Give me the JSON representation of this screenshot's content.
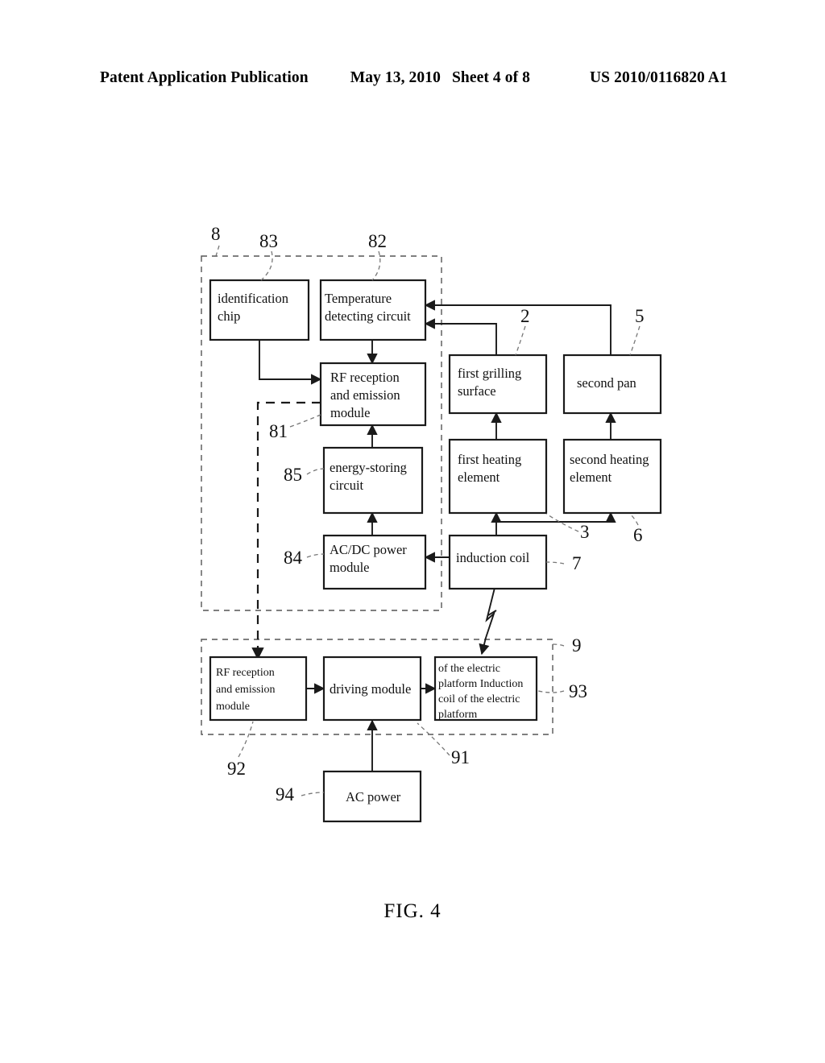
{
  "header": {
    "title": "Patent Application Publication",
    "date": "May 13, 2010",
    "sheet": "Sheet 4 of 8",
    "publication_number": "US 2010/0116820 A1"
  },
  "figure": {
    "caption": "FIG. 4"
  },
  "nodes": {
    "identification_chip": "identification chip",
    "temperature_detecting_circuit": "Temperature detecting circuit",
    "rf_module_upper": "RF reception and emission module",
    "energy_storing_circuit": "energy-storing circuit",
    "acdc_power_module": "AC/DC power module",
    "first_grilling_surface": "first grilling surface",
    "second_pan": "second pan",
    "first_heating_element": "first heating element",
    "second_heating_element": "second heating element",
    "induction_coil": "induction coil",
    "rf_module_lower": "RF reception and emission module",
    "driving_module": "driving module",
    "platform_induction_coil": "of the electric platform Induction coil of the electric platform",
    "ac_power": "AC power"
  },
  "node_lines": {
    "identification_chip": [
      "identification",
      "chip"
    ],
    "temperature_detecting_circuit": [
      "Temperature",
      "detecting circuit"
    ],
    "rf_module_upper": [
      "RF reception",
      "and emission",
      "module"
    ],
    "energy_storing_circuit": [
      "energy-storing",
      "circuit"
    ],
    "acdc_power_module": [
      "AC/DC power",
      "module"
    ],
    "first_grilling_surface": [
      "first grilling",
      "surface"
    ],
    "second_pan": [
      "second pan"
    ],
    "first_heating_element": [
      "first heating",
      "element"
    ],
    "second_heating_element": [
      "second heating",
      "element"
    ],
    "induction_coil": [
      "induction coil"
    ],
    "rf_module_lower": [
      "RF reception",
      "and emission",
      "module"
    ],
    "driving_module": [
      "driving module"
    ],
    "platform_induction_coil": [
      "of the electric",
      "platform Induction",
      "coil of the electric",
      "platform"
    ],
    "ac_power": [
      "AC power"
    ]
  },
  "reference_numerals": {
    "device_group": "8",
    "identification_chip": "83",
    "temperature_detecting_circuit": "82",
    "rf_module_upper": "81",
    "energy_storing_circuit": "85",
    "acdc_power_module": "84",
    "first_grilling_surface": "2",
    "second_pan": "5",
    "first_heating_element": "3",
    "second_heating_element": "6",
    "induction_coil": "7",
    "platform_group": "9",
    "driving_module": "91",
    "rf_module_lower": "92",
    "platform_induction_coil": "93",
    "ac_power": "94"
  },
  "colors": {
    "ink": "#1a1a1a",
    "group_outline": "#555555",
    "leader": "#777777",
    "paper": "#ffffff"
  }
}
